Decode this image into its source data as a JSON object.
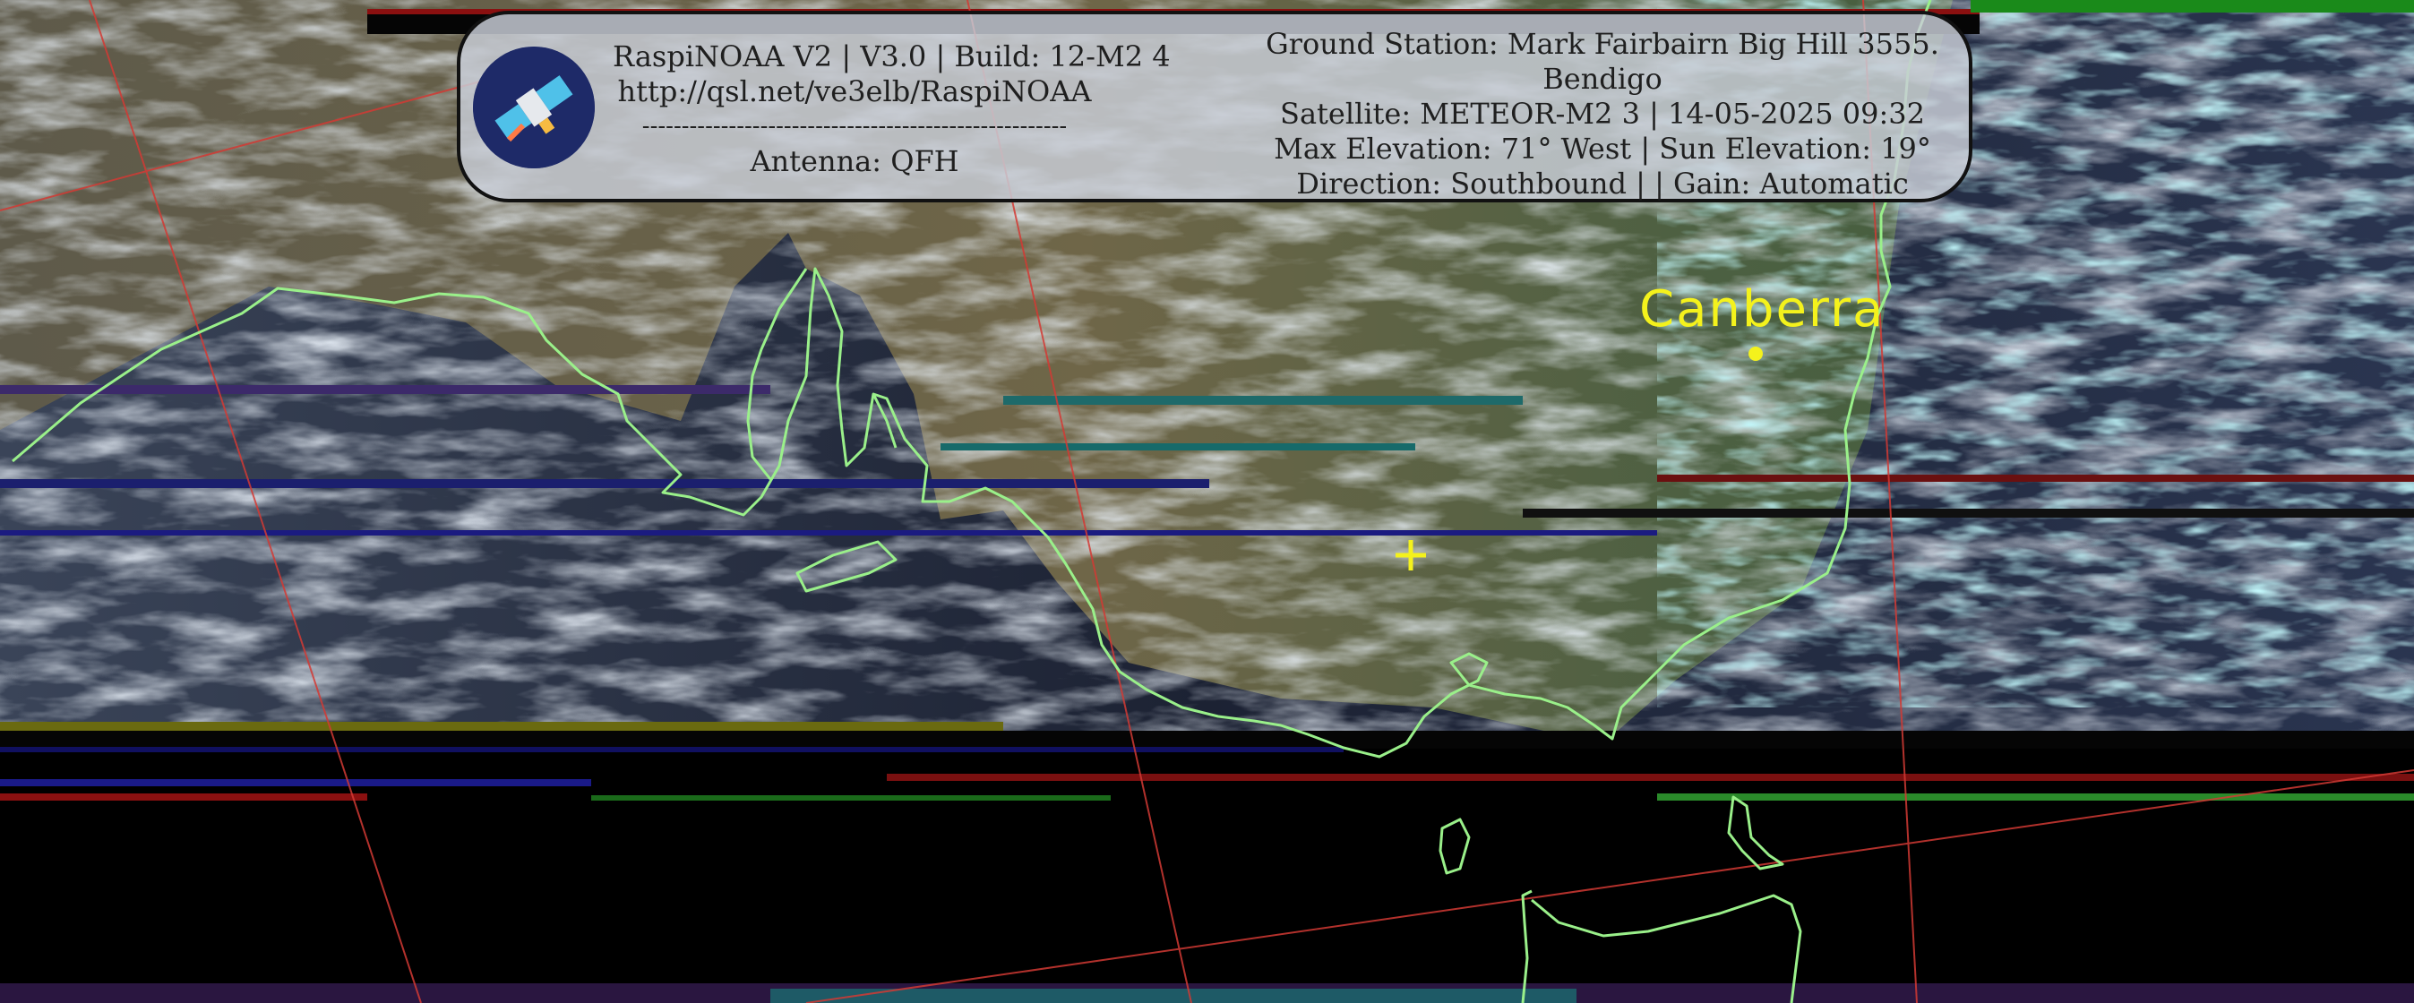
{
  "overlay": {
    "title_line": "RaspiNOAA V2 | V3.0 | Build: 12-M2 4",
    "url": "http://qsl.net/ve3elb/RaspiNOAA",
    "divider": "------------------------------------------------------",
    "antenna": "Antenna: QFH",
    "ground_station": "Ground Station: Mark Fairbairn Big Hill 3555.",
    "ground_station_cont": "Bendigo",
    "satellite": "Satellite: METEOR-M2 3 | 14-05-2025 09:32",
    "elevation": "Max Elevation: 71° West | Sun Elevation: 19°",
    "direction": "Direction: Southbound | | Gain: Automatic"
  },
  "map": {
    "city_label": "Canberra",
    "coastline_color": "#9af08a",
    "marker_color": "#f4f21c",
    "graticule_color": "#d23a34"
  },
  "icons": {
    "logo": "satellite-icon"
  }
}
